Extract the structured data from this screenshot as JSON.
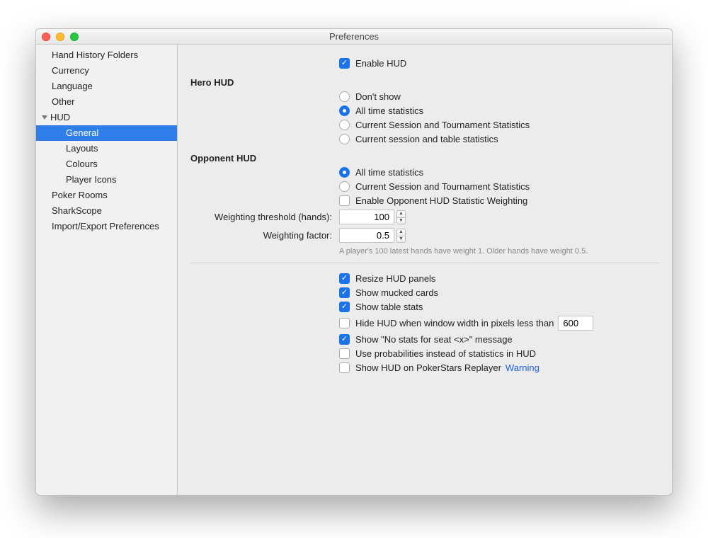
{
  "window": {
    "title": "Preferences"
  },
  "sidebar": {
    "items": [
      {
        "label": "Hand History Folders",
        "level": 1
      },
      {
        "label": "Currency",
        "level": 1
      },
      {
        "label": "Language",
        "level": 1
      },
      {
        "label": "Other",
        "level": 1
      },
      {
        "label": "HUD",
        "level": 1,
        "expandable": true
      },
      {
        "label": "General",
        "level": 2,
        "selected": true
      },
      {
        "label": "Layouts",
        "level": 2
      },
      {
        "label": "Colours",
        "level": 2
      },
      {
        "label": "Player Icons",
        "level": 2
      },
      {
        "label": "Poker Rooms",
        "level": 1
      },
      {
        "label": "SharkScope",
        "level": 1
      },
      {
        "label": "Import/Export Preferences",
        "level": 1
      }
    ]
  },
  "main": {
    "enable_hud": "Enable HUD",
    "hero_hud_title": "Hero HUD",
    "hero_options": [
      "Don't show",
      "All time statistics",
      "Current Session and Tournament Statistics",
      "Current session and table statistics"
    ],
    "hero_selected_index": 1,
    "opponent_hud_title": "Opponent HUD",
    "opponent_options": [
      "All time statistics",
      "Current Session and Tournament Statistics"
    ],
    "opponent_selected_index": 0,
    "enable_weighting": "Enable Opponent HUD Statistic Weighting",
    "weight_threshold_label": "Weighting threshold (hands):",
    "weight_threshold_value": "100",
    "weight_factor_label": "Weighting factor:",
    "weight_factor_value": "0.5",
    "weight_hint": "A player's 100 latest hands have weight 1. Older hands have weight 0.5.",
    "checks": [
      {
        "label": "Resize HUD panels",
        "checked": true
      },
      {
        "label": "Show mucked cards",
        "checked": true
      },
      {
        "label": "Show table stats",
        "checked": true
      },
      {
        "label": "Hide HUD when window width in pixels less than",
        "checked": false,
        "numeric": "600"
      },
      {
        "label": "Show \"No stats for seat <x>\" message",
        "checked": true
      },
      {
        "label": "Use probabilities instead of statistics in HUD",
        "checked": false
      },
      {
        "label": "Show HUD on PokerStars Replayer",
        "checked": false,
        "warning": "Warning"
      }
    ]
  }
}
